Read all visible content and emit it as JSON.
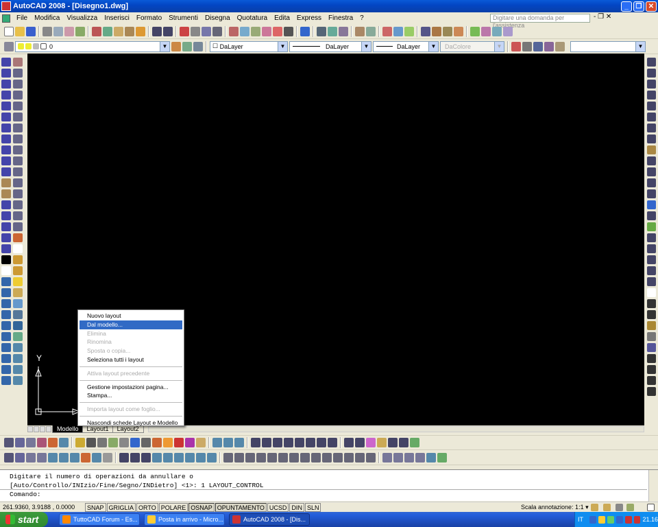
{
  "window": {
    "title": "AutoCAD 2008 - [Disegno1.dwg]",
    "minimize": "_",
    "restore": "❐",
    "close": "✕"
  },
  "menu": {
    "items": [
      "File",
      "Modifica",
      "Visualizza",
      "Inserisci",
      "Formato",
      "Strumenti",
      "Disegna",
      "Quotatura",
      "Edita",
      "Express",
      "Finestra",
      "?"
    ],
    "help_placeholder": "Digitare una domanda per l'assistenza",
    "doc_controls": "- ❐ ✕"
  },
  "properties_toolbar": {
    "layer": "0",
    "color": "DaLayer",
    "linetype": "DaLayer",
    "lineweight": "DaLayer",
    "plotstyle": "DaColore",
    "color_prefix": "☐"
  },
  "canvas": {
    "ucs_y_label": "Y"
  },
  "layout_tabs": [
    "Modello",
    "Layout1",
    "Layout2"
  ],
  "context_menu": {
    "items": [
      {
        "label": "Nuovo layout",
        "state": "normal"
      },
      {
        "label": "Dal modello...",
        "state": "highlight"
      },
      {
        "label": "Elimina",
        "state": "disabled"
      },
      {
        "label": "Rinomina",
        "state": "disabled"
      },
      {
        "label": "Sposta o copia...",
        "state": "disabled"
      },
      {
        "label": "Seleziona tutti i layout",
        "state": "normal"
      },
      {
        "label": "Attiva layout precedente",
        "state": "disabled"
      },
      {
        "label": "Gestione impostazioni pagina...",
        "state": "normal"
      },
      {
        "label": "Stampa...",
        "state": "normal"
      },
      {
        "label": "Importa layout come foglio...",
        "state": "disabled"
      },
      {
        "label": "Nascondi schede Layout e Modello",
        "state": "normal"
      }
    ]
  },
  "command": {
    "line1": "Digitare il numero di operazioni da annullare o",
    "line2": "[Auto/Controllo/INIzio/Fine/Segno/INDietro] <1>: 1 LAYOUT_CONTROL",
    "prompt": "Comando:"
  },
  "status": {
    "coords": "261.9360, 3.9188 , 0.0000",
    "toggles": [
      {
        "label": "SNAP",
        "on": false
      },
      {
        "label": "GRIGLIA",
        "on": false
      },
      {
        "label": "ORTO",
        "on": false
      },
      {
        "label": "POLARE",
        "on": false
      },
      {
        "label": "OSNAP",
        "on": true
      },
      {
        "label": "OPUNTAMENTO",
        "on": true
      },
      {
        "label": "UCSD",
        "on": false
      },
      {
        "label": "DIN",
        "on": false
      },
      {
        "label": "SLN",
        "on": false
      }
    ],
    "annotation_scale": "Scala annotazione: 1:1 ▾"
  },
  "taskbar": {
    "start": "start",
    "tasks": [
      {
        "label": "TuttoCAD Forum - Es...",
        "active": false
      },
      {
        "label": "Posta in arrivo - Micro...",
        "active": false
      },
      {
        "label": "AutoCAD 2008 - [Dis...",
        "active": true
      }
    ],
    "lang": "IT",
    "clock": "21.16"
  }
}
